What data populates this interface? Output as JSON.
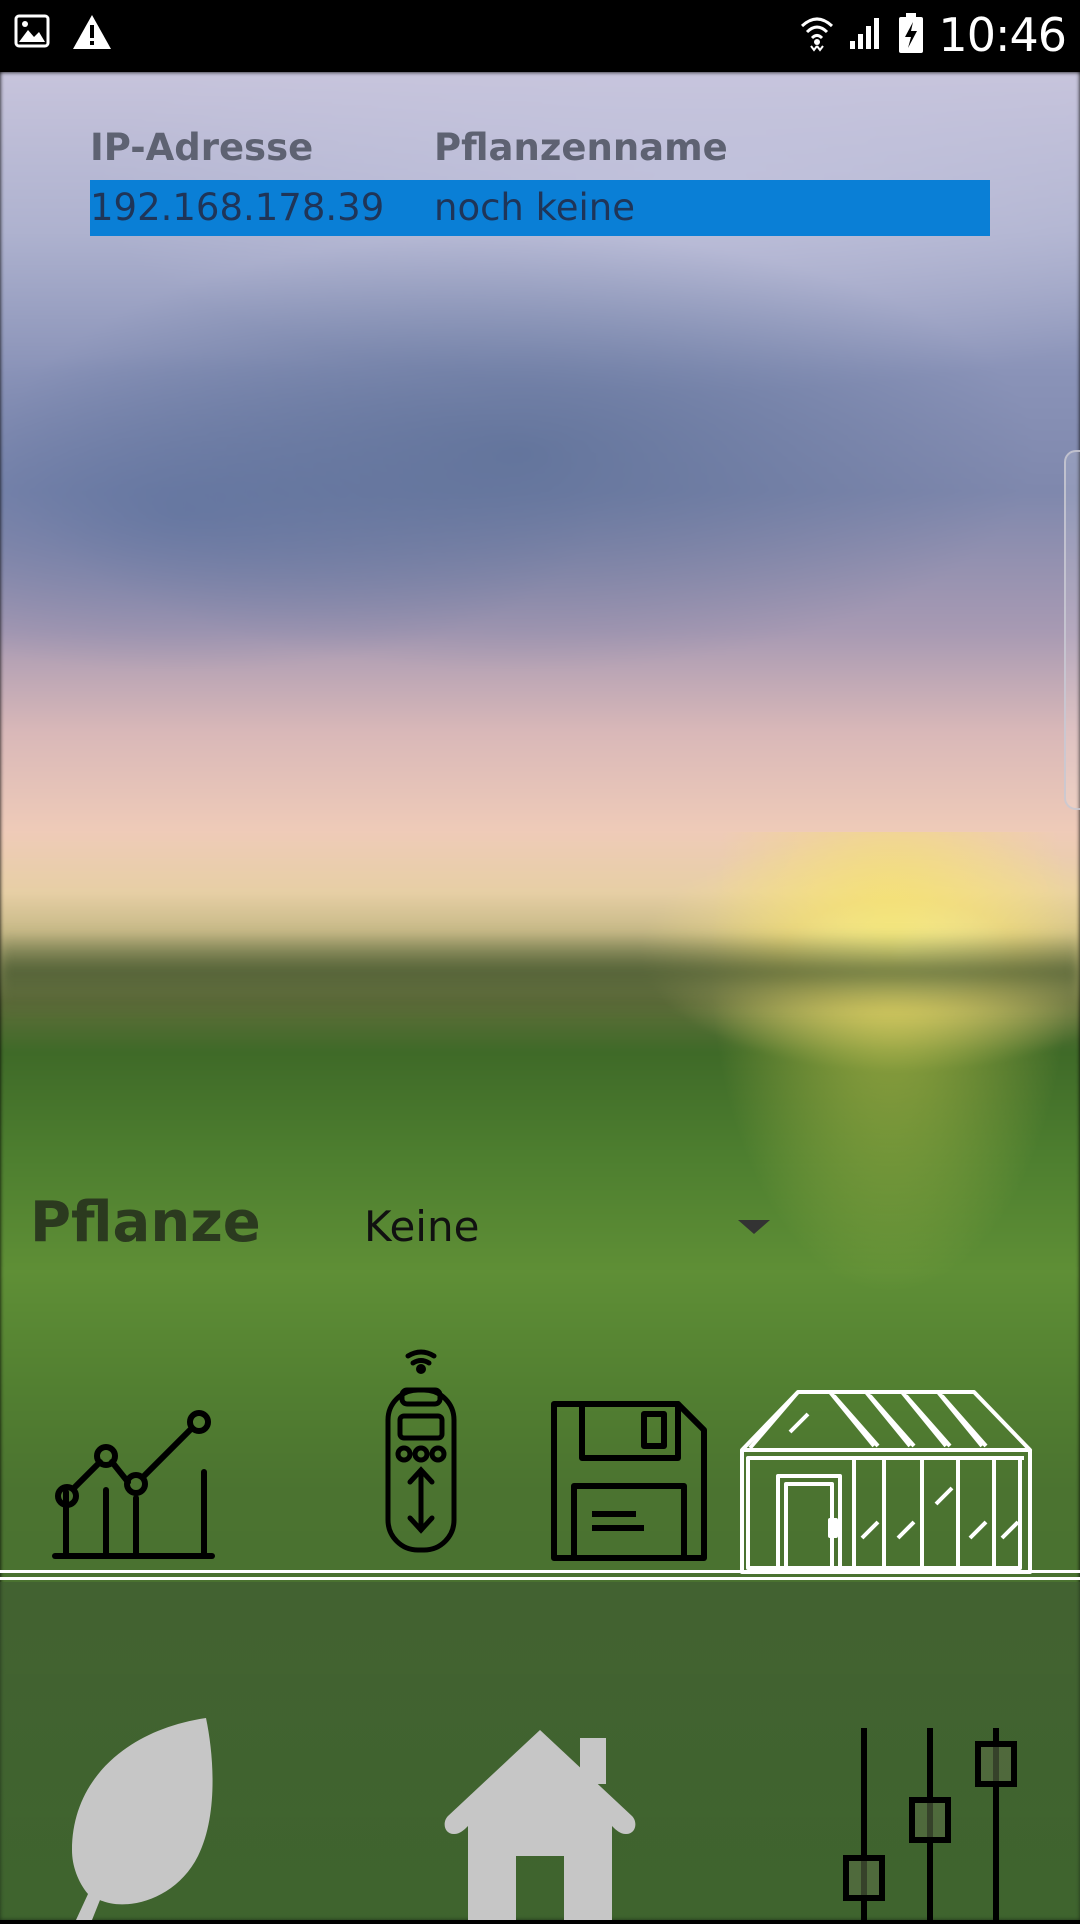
{
  "status_bar": {
    "time": "10:46",
    "left_icons": [
      "image-icon",
      "warning-icon"
    ],
    "right_icons": [
      "wifi-icon",
      "signal-icon",
      "battery-charging-icon"
    ]
  },
  "device_table": {
    "columns": [
      "IP-Adresse",
      "Pflanzenname"
    ],
    "rows": [
      {
        "ip": "192.168.178.39",
        "plant": "noch keine",
        "selected": true
      }
    ],
    "selected_color": "#0a7fd6"
  },
  "plant_selector": {
    "label": "Pflanze",
    "value": "Keine"
  },
  "tools": [
    "chart-icon",
    "remote-control-icon",
    "save-icon",
    "greenhouse-icon"
  ],
  "bottom_nav": [
    "leaf-icon",
    "home-icon",
    "sliders-icon"
  ]
}
